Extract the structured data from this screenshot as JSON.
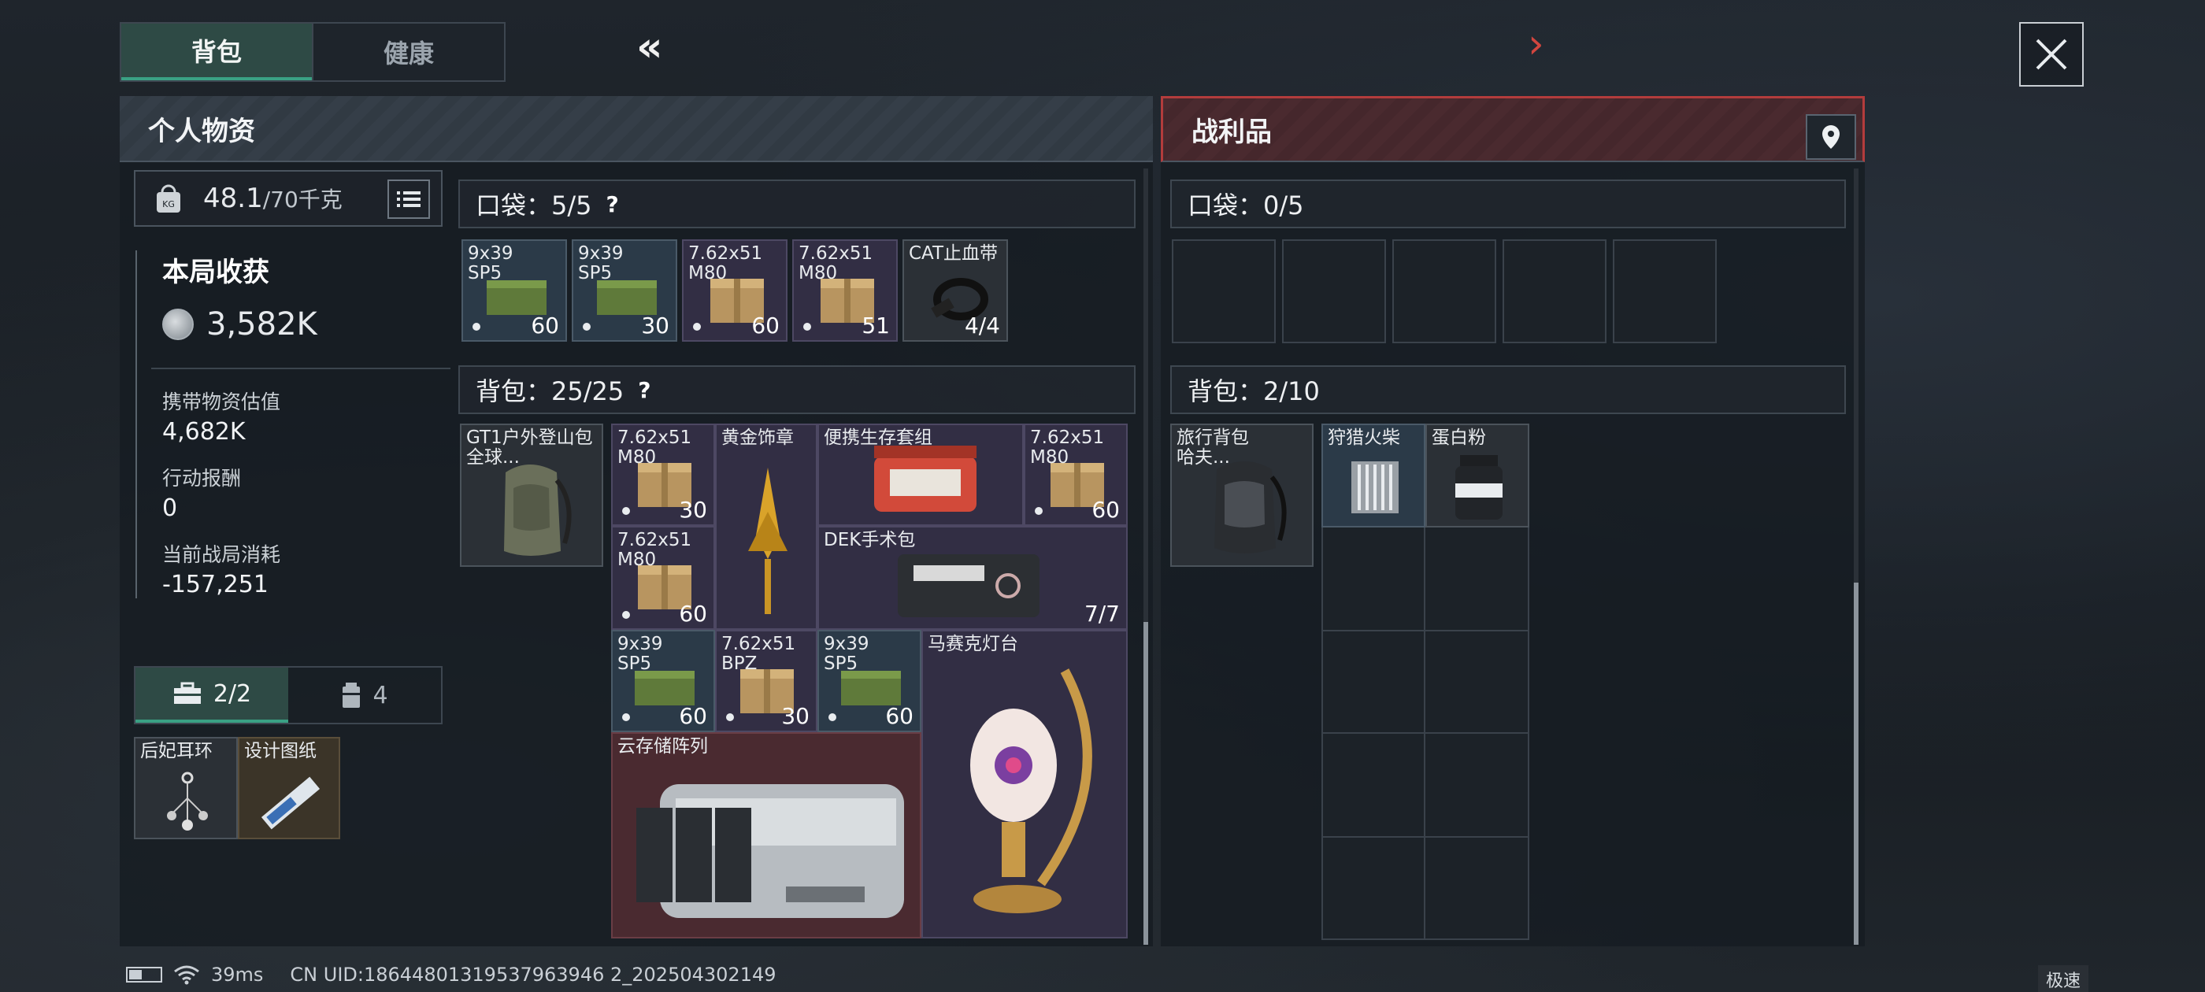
{
  "tabs": {
    "backpack": "背包",
    "health": "健康"
  },
  "nav": {
    "prev": "«",
    "next": "›"
  },
  "left_panel": {
    "title": "个人物资",
    "weight": {
      "current": "48.1",
      "max": "/70千克"
    },
    "stats": {
      "round_title": "本局收获",
      "round_value": "3,582K",
      "carry_label": "携带物资估值",
      "carry_value": "4,682K",
      "reward_label": "行动报酬",
      "reward_value": "0",
      "cost_label": "当前战局消耗",
      "cost_value": "-157,251"
    },
    "lower_tabs": {
      "tab1": "2/2",
      "tab2": "4"
    },
    "safe_items": [
      {
        "name": "后妃耳环"
      },
      {
        "name": "设计图纸"
      }
    ],
    "pocket_label": "口袋：5/5",
    "help": "?",
    "pocket_items": [
      {
        "name": "9x39\nSP5",
        "count": "60"
      },
      {
        "name": "9x39\nSP5",
        "count": "30"
      },
      {
        "name": "7.62x51\nM80",
        "count": "60"
      },
      {
        "name": "7.62x51\nM80",
        "count": "51"
      },
      {
        "name": "CAT止血带",
        "count": "4/4"
      }
    ],
    "bag_label": "背包：25/25",
    "bag_equipped": {
      "name": "GT1户外登山包\n全球..."
    },
    "bag_items": [
      {
        "name": "7.62x51\nM80",
        "count": "30"
      },
      {
        "name": "黄金饰章",
        "count": ""
      },
      {
        "name": "便携生存套组",
        "count": ""
      },
      {
        "name": "7.62x51\nM80",
        "count": "60"
      },
      {
        "name": "7.62x51\nM80",
        "count": "60"
      },
      {
        "name": "DEK手术包",
        "count": "7/7"
      },
      {
        "name": "9x39\nSP5",
        "count": "60"
      },
      {
        "name": "7.62x51\nBPZ",
        "count": "30"
      },
      {
        "name": "9x39\nSP5",
        "count": "60"
      },
      {
        "name": "马赛克灯台",
        "count": ""
      },
      {
        "name": "云存储阵列",
        "count": ""
      }
    ]
  },
  "right_panel": {
    "title": "战利品",
    "pocket_label": "口袋：0/5",
    "bag_label": "背包：2/10",
    "bag_equipped": {
      "name": "旅行背包\n哈夫..."
    },
    "bag_items": [
      {
        "name": "狩猎火柴"
      },
      {
        "name": "蛋白粉"
      }
    ]
  },
  "footer": {
    "ping": "39ms",
    "uid": "CN UID:18644801319537963946 2_202504302149",
    "speed": "极速"
  },
  "colors": {
    "accent_green": "#3aa184",
    "accent_red": "#b33c3c"
  }
}
